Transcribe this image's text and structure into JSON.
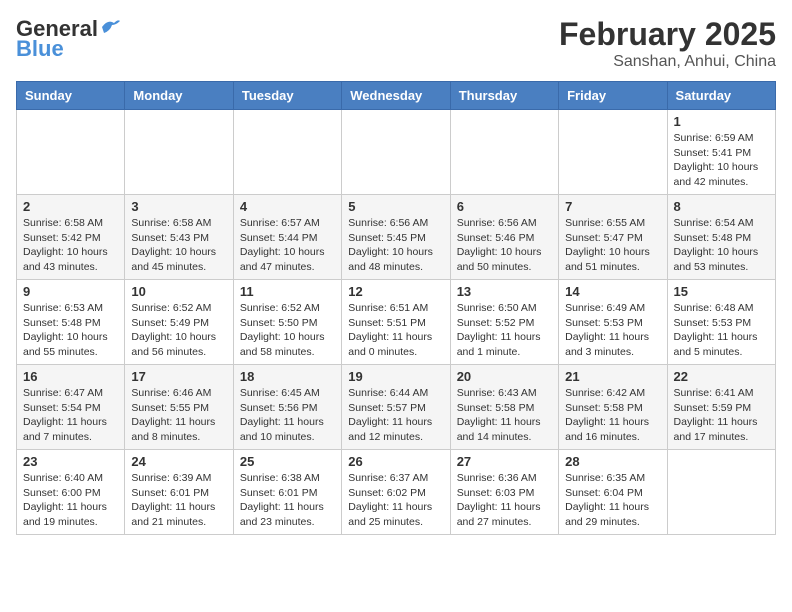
{
  "header": {
    "logo_general": "General",
    "logo_blue": "Blue",
    "month_title": "February 2025",
    "subtitle": "Sanshan, Anhui, China"
  },
  "days_of_week": [
    "Sunday",
    "Monday",
    "Tuesday",
    "Wednesday",
    "Thursday",
    "Friday",
    "Saturday"
  ],
  "weeks": [
    [
      {
        "day": "",
        "info": ""
      },
      {
        "day": "",
        "info": ""
      },
      {
        "day": "",
        "info": ""
      },
      {
        "day": "",
        "info": ""
      },
      {
        "day": "",
        "info": ""
      },
      {
        "day": "",
        "info": ""
      },
      {
        "day": "1",
        "info": "Sunrise: 6:59 AM\nSunset: 5:41 PM\nDaylight: 10 hours and 42 minutes."
      }
    ],
    [
      {
        "day": "2",
        "info": "Sunrise: 6:58 AM\nSunset: 5:42 PM\nDaylight: 10 hours and 43 minutes."
      },
      {
        "day": "3",
        "info": "Sunrise: 6:58 AM\nSunset: 5:43 PM\nDaylight: 10 hours and 45 minutes."
      },
      {
        "day": "4",
        "info": "Sunrise: 6:57 AM\nSunset: 5:44 PM\nDaylight: 10 hours and 47 minutes."
      },
      {
        "day": "5",
        "info": "Sunrise: 6:56 AM\nSunset: 5:45 PM\nDaylight: 10 hours and 48 minutes."
      },
      {
        "day": "6",
        "info": "Sunrise: 6:56 AM\nSunset: 5:46 PM\nDaylight: 10 hours and 50 minutes."
      },
      {
        "day": "7",
        "info": "Sunrise: 6:55 AM\nSunset: 5:47 PM\nDaylight: 10 hours and 51 minutes."
      },
      {
        "day": "8",
        "info": "Sunrise: 6:54 AM\nSunset: 5:48 PM\nDaylight: 10 hours and 53 minutes."
      }
    ],
    [
      {
        "day": "9",
        "info": "Sunrise: 6:53 AM\nSunset: 5:48 PM\nDaylight: 10 hours and 55 minutes."
      },
      {
        "day": "10",
        "info": "Sunrise: 6:52 AM\nSunset: 5:49 PM\nDaylight: 10 hours and 56 minutes."
      },
      {
        "day": "11",
        "info": "Sunrise: 6:52 AM\nSunset: 5:50 PM\nDaylight: 10 hours and 58 minutes."
      },
      {
        "day": "12",
        "info": "Sunrise: 6:51 AM\nSunset: 5:51 PM\nDaylight: 11 hours and 0 minutes."
      },
      {
        "day": "13",
        "info": "Sunrise: 6:50 AM\nSunset: 5:52 PM\nDaylight: 11 hours and 1 minute."
      },
      {
        "day": "14",
        "info": "Sunrise: 6:49 AM\nSunset: 5:53 PM\nDaylight: 11 hours and 3 minutes."
      },
      {
        "day": "15",
        "info": "Sunrise: 6:48 AM\nSunset: 5:53 PM\nDaylight: 11 hours and 5 minutes."
      }
    ],
    [
      {
        "day": "16",
        "info": "Sunrise: 6:47 AM\nSunset: 5:54 PM\nDaylight: 11 hours and 7 minutes."
      },
      {
        "day": "17",
        "info": "Sunrise: 6:46 AM\nSunset: 5:55 PM\nDaylight: 11 hours and 8 minutes."
      },
      {
        "day": "18",
        "info": "Sunrise: 6:45 AM\nSunset: 5:56 PM\nDaylight: 11 hours and 10 minutes."
      },
      {
        "day": "19",
        "info": "Sunrise: 6:44 AM\nSunset: 5:57 PM\nDaylight: 11 hours and 12 minutes."
      },
      {
        "day": "20",
        "info": "Sunrise: 6:43 AM\nSunset: 5:58 PM\nDaylight: 11 hours and 14 minutes."
      },
      {
        "day": "21",
        "info": "Sunrise: 6:42 AM\nSunset: 5:58 PM\nDaylight: 11 hours and 16 minutes."
      },
      {
        "day": "22",
        "info": "Sunrise: 6:41 AM\nSunset: 5:59 PM\nDaylight: 11 hours and 17 minutes."
      }
    ],
    [
      {
        "day": "23",
        "info": "Sunrise: 6:40 AM\nSunset: 6:00 PM\nDaylight: 11 hours and 19 minutes."
      },
      {
        "day": "24",
        "info": "Sunrise: 6:39 AM\nSunset: 6:01 PM\nDaylight: 11 hours and 21 minutes."
      },
      {
        "day": "25",
        "info": "Sunrise: 6:38 AM\nSunset: 6:01 PM\nDaylight: 11 hours and 23 minutes."
      },
      {
        "day": "26",
        "info": "Sunrise: 6:37 AM\nSunset: 6:02 PM\nDaylight: 11 hours and 25 minutes."
      },
      {
        "day": "27",
        "info": "Sunrise: 6:36 AM\nSunset: 6:03 PM\nDaylight: 11 hours and 27 minutes."
      },
      {
        "day": "28",
        "info": "Sunrise: 6:35 AM\nSunset: 6:04 PM\nDaylight: 11 hours and 29 minutes."
      },
      {
        "day": "",
        "info": ""
      }
    ]
  ]
}
